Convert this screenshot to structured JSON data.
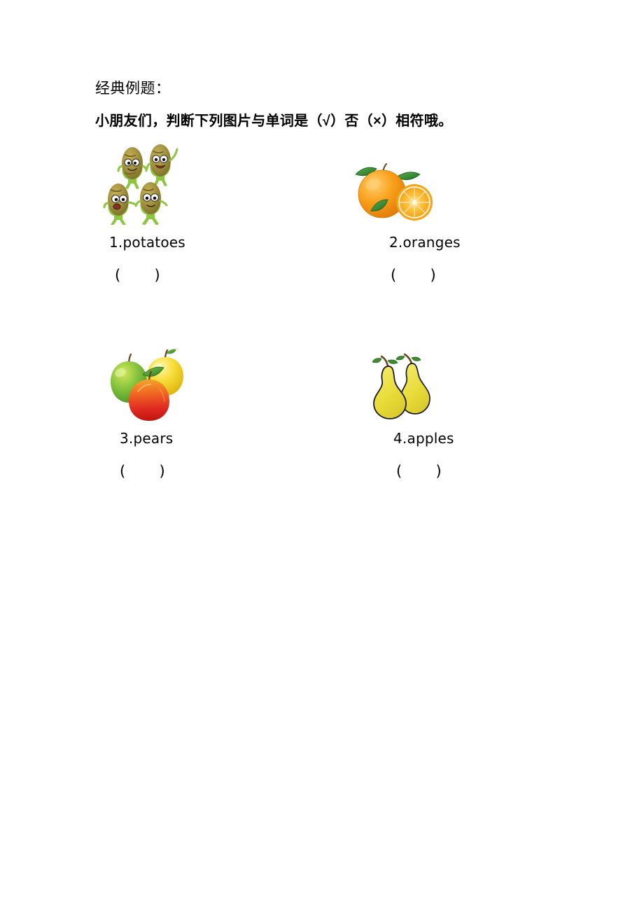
{
  "document": {
    "heading": "经典例题：",
    "instruction": "小朋友们，判断下列图片与单词是（√）否（×）相符哦。",
    "answer_blank": "(       )"
  },
  "questions": [
    {
      "number": "1",
      "label": "1.potatoes",
      "word": "potatoes",
      "blank": "(       )",
      "image": "potatoes-clipart",
      "image_description": "four cartoon potato characters with faces, arms and legs"
    },
    {
      "number": "2",
      "label": "2.oranges",
      "word": "oranges",
      "blank": "(       )",
      "image": "oranges-clipart",
      "image_description": "a whole orange with green leaves beside a halved orange"
    },
    {
      "number": "3",
      "label": "3.pears",
      "word": "pears",
      "blank": "(       )",
      "image": "apples-clipart",
      "image_description": "three apples: green, yellow and a red one in front"
    },
    {
      "number": "4",
      "label": "4.apples",
      "word": "apples",
      "blank": "(       )",
      "image": "pears-clipart",
      "image_description": "two yellow pears with brown stems and green leaves"
    }
  ],
  "colors": {
    "page_background": "#ffffff",
    "text": "#000000",
    "potato_body": "#9a8b3e",
    "potato_limb": "#8cc63f",
    "orange_flesh": "#f7a81b",
    "orange_peel": "#f59a12",
    "orange_leaf": "#2e7d32",
    "apple_green": "#7cc241",
    "apple_yellow": "#f5d936",
    "apple_red": "#e02a22",
    "pear_body": "#eade3c",
    "pear_outline": "#1a1a1a",
    "stem_brown": "#6b4420"
  }
}
